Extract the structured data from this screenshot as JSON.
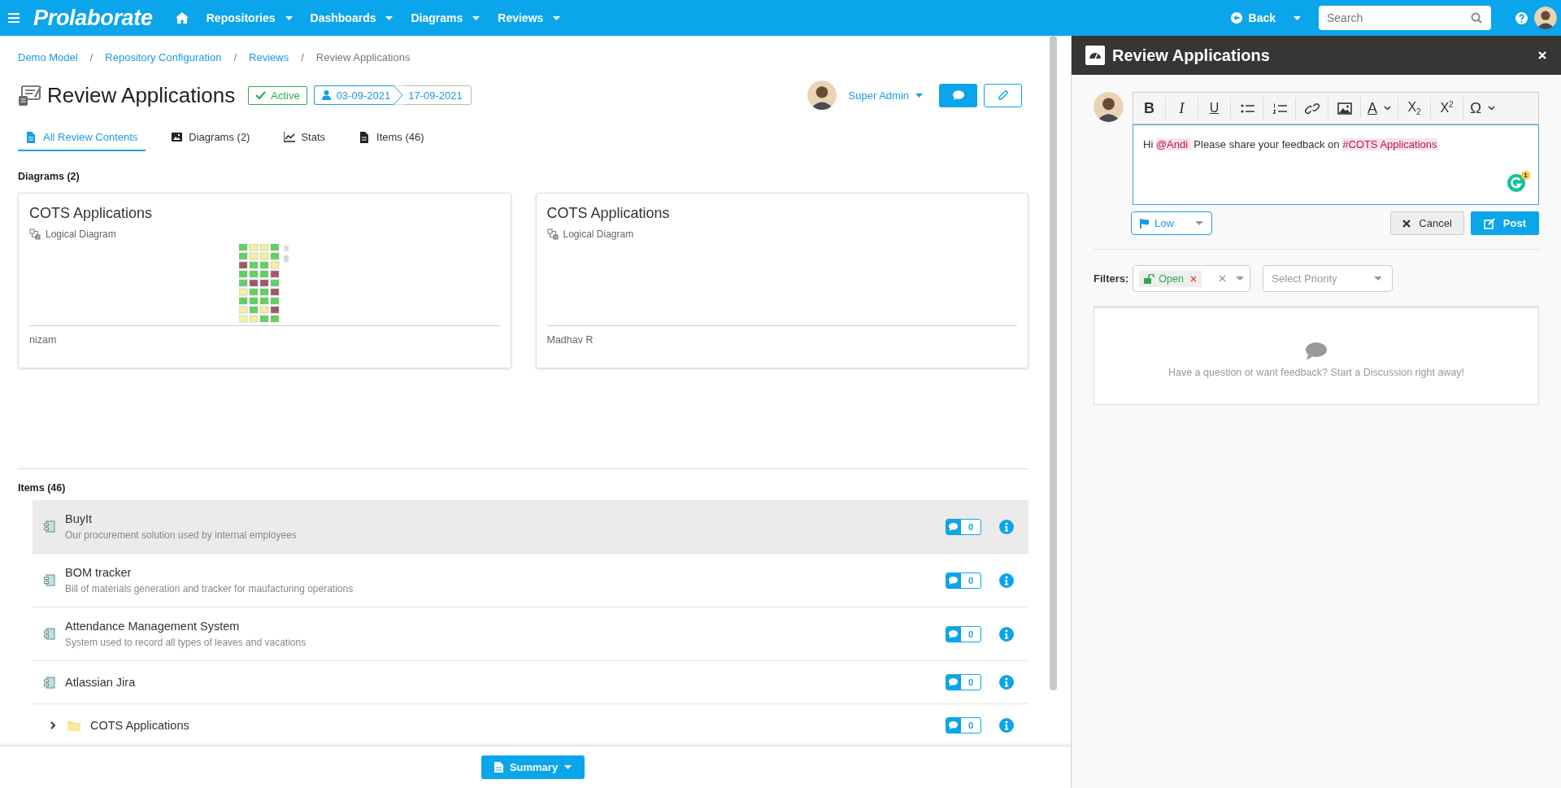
{
  "topbar": {
    "logo": "Prolaborate",
    "nav": [
      {
        "label": "Repositories"
      },
      {
        "label": "Dashboards"
      },
      {
        "label": "Diagrams"
      },
      {
        "label": "Reviews"
      }
    ],
    "back": "Back",
    "search": {
      "placeholder": "Search"
    }
  },
  "breadcrumb": [
    {
      "kind": "link",
      "label": "Demo Model"
    },
    {
      "kind": "separator",
      "label": "/"
    },
    {
      "kind": "link",
      "label": "Repository Configuration"
    },
    {
      "kind": "separator",
      "label": "/"
    },
    {
      "kind": "link",
      "label": "Reviews"
    },
    {
      "kind": "separator",
      "label": "/"
    },
    {
      "kind": "current",
      "label": "Review Applications"
    }
  ],
  "review": {
    "title": "Review Applications",
    "status": "Active",
    "start_date": "03-09-2021",
    "end_date": "17-09-2021",
    "owner": "Super Admin"
  },
  "tabs": [
    {
      "label": "All Review Contents",
      "selected": true
    },
    {
      "label": "Diagrams (2)",
      "selected": false
    },
    {
      "label": "Stats",
      "selected": false
    },
    {
      "label": "Items (46)",
      "selected": false
    }
  ],
  "diagrams": {
    "heading": "Diagrams (2)",
    "cards": [
      {
        "title": "COTS Applications",
        "type": "Logical Diagram",
        "author": "nizam",
        "thumbnail": true
      },
      {
        "title": "COTS Applications",
        "type": "Logical Diagram",
        "author": "Madhav R",
        "thumbnail": false
      }
    ]
  },
  "items": {
    "heading": "Items (46)",
    "rows": [
      {
        "kind": "component",
        "title": "BuyIt",
        "description": "Our procurement solution used by internal employees",
        "comments": "0",
        "selected": true
      },
      {
        "kind": "component",
        "title": "BOM tracker",
        "description": "Bill of materials generation and tracker for maufacturing operations",
        "comments": "0",
        "selected": false
      },
      {
        "kind": "component",
        "title": "Attendance Management System",
        "description": "System used to record all types of leaves and vacations",
        "comments": "0",
        "selected": false
      },
      {
        "kind": "component",
        "title": "Atlassian Jira",
        "comments": "0",
        "selected": false
      },
      {
        "kind": "folder",
        "title": "COTS Applications",
        "comments": "0",
        "selected": false,
        "expanded": false
      }
    ]
  },
  "summary_button": "Summary",
  "panel": {
    "title": "Review Applications",
    "toolbar": [
      {
        "kind": "bold",
        "label": "B"
      },
      {
        "kind": "italic",
        "label": "I"
      },
      {
        "kind": "underline",
        "label": "U"
      },
      {
        "kind": "bullets"
      },
      {
        "kind": "numbered"
      },
      {
        "kind": "link"
      },
      {
        "kind": "image"
      },
      {
        "kind": "color",
        "label": "A",
        "dropdown": true
      },
      {
        "kind": "subscript",
        "label": "X$_{2}$"
      },
      {
        "kind": "superscript",
        "label": "X$^{2}$"
      },
      {
        "kind": "special",
        "label": "Ω",
        "dropdown": true
      }
    ],
    "message": [
      {
        "kind": "plain",
        "text": "Hi "
      },
      {
        "kind": "mention",
        "text": "@Andi "
      },
      {
        "kind": "plain",
        "text": " Please share your feedback on "
      },
      {
        "kind": "tag",
        "text": "#COTS Applications"
      }
    ],
    "grammar_count": "1",
    "priority": "Low",
    "cancel": "Cancel",
    "post": "Post",
    "filters_label": "Filters:",
    "filter_tags": [
      {
        "label": "Open"
      }
    ],
    "priority_filter": {
      "placeholder": "Select Priority"
    },
    "empty_message": "Have a question or want feedback? Start a Discussion right away!"
  }
}
